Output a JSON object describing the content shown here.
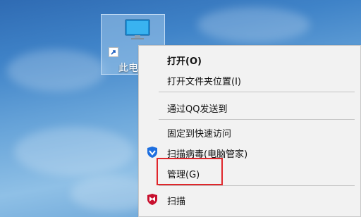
{
  "desktop": {
    "icon_label": "此电",
    "icon_name": "this-pc-monitor-icon"
  },
  "menu": {
    "open": "打开(O)",
    "open_location": "打开文件夹位置(I)",
    "send_qq": "通过QQ发送到",
    "pin_quick_access": "固定到快速访问",
    "scan_virus": "扫描病毒(电脑管家)",
    "manage": "管理(G)",
    "scan": "扫描"
  },
  "colors": {
    "highlight_border": "#e0262b",
    "tencent_shield": "#1e6fe0",
    "mcafee_red": "#c8102e"
  }
}
